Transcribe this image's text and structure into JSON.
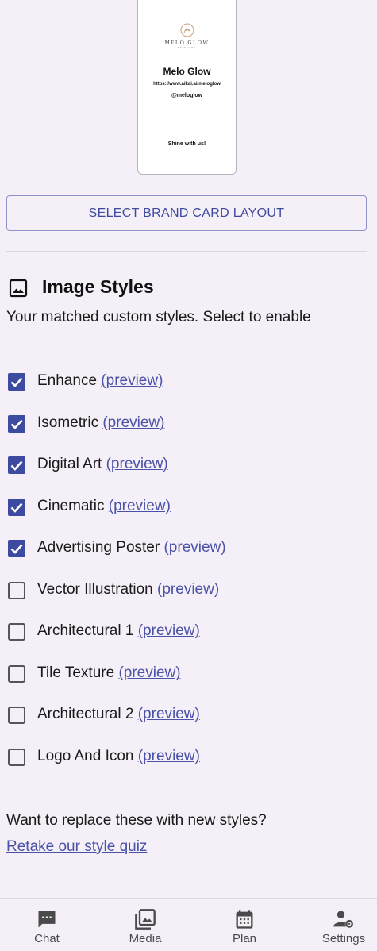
{
  "brand_card": {
    "logo_word": "MELO GLOW",
    "logo_sub": "SKINCARE",
    "name": "Melo Glow",
    "url": "https://www.aikai.ai/meloglow",
    "handle": "@meloglow",
    "tagline": "Shine with us!"
  },
  "select_layout_button": "SELECT BRAND CARD LAYOUT",
  "image_styles": {
    "title": "Image Styles",
    "subtitle": "Your matched custom styles. Select to enable",
    "preview_label": "(preview)",
    "items": [
      {
        "label": "Enhance",
        "checked": true
      },
      {
        "label": "Isometric",
        "checked": true
      },
      {
        "label": "Digital Art",
        "checked": true
      },
      {
        "label": "Cinematic",
        "checked": true
      },
      {
        "label": "Advertising Poster",
        "checked": true
      },
      {
        "label": "Vector Illustration",
        "checked": false
      },
      {
        "label": "Architectural 1",
        "checked": false
      },
      {
        "label": "Tile Texture",
        "checked": false
      },
      {
        "label": "Architectural 2",
        "checked": false
      },
      {
        "label": "Logo And Icon",
        "checked": false
      }
    ]
  },
  "replace_prompt": "Want to replace these with new styles?",
  "retake_link": "Retake our style quiz",
  "bottom_nav": {
    "chat": "Chat",
    "media": "Media",
    "plan": "Plan",
    "settings": "Settings"
  },
  "colors": {
    "accent": "#3c4aa0",
    "link": "#4a52a8",
    "background": "#f5eff7"
  }
}
